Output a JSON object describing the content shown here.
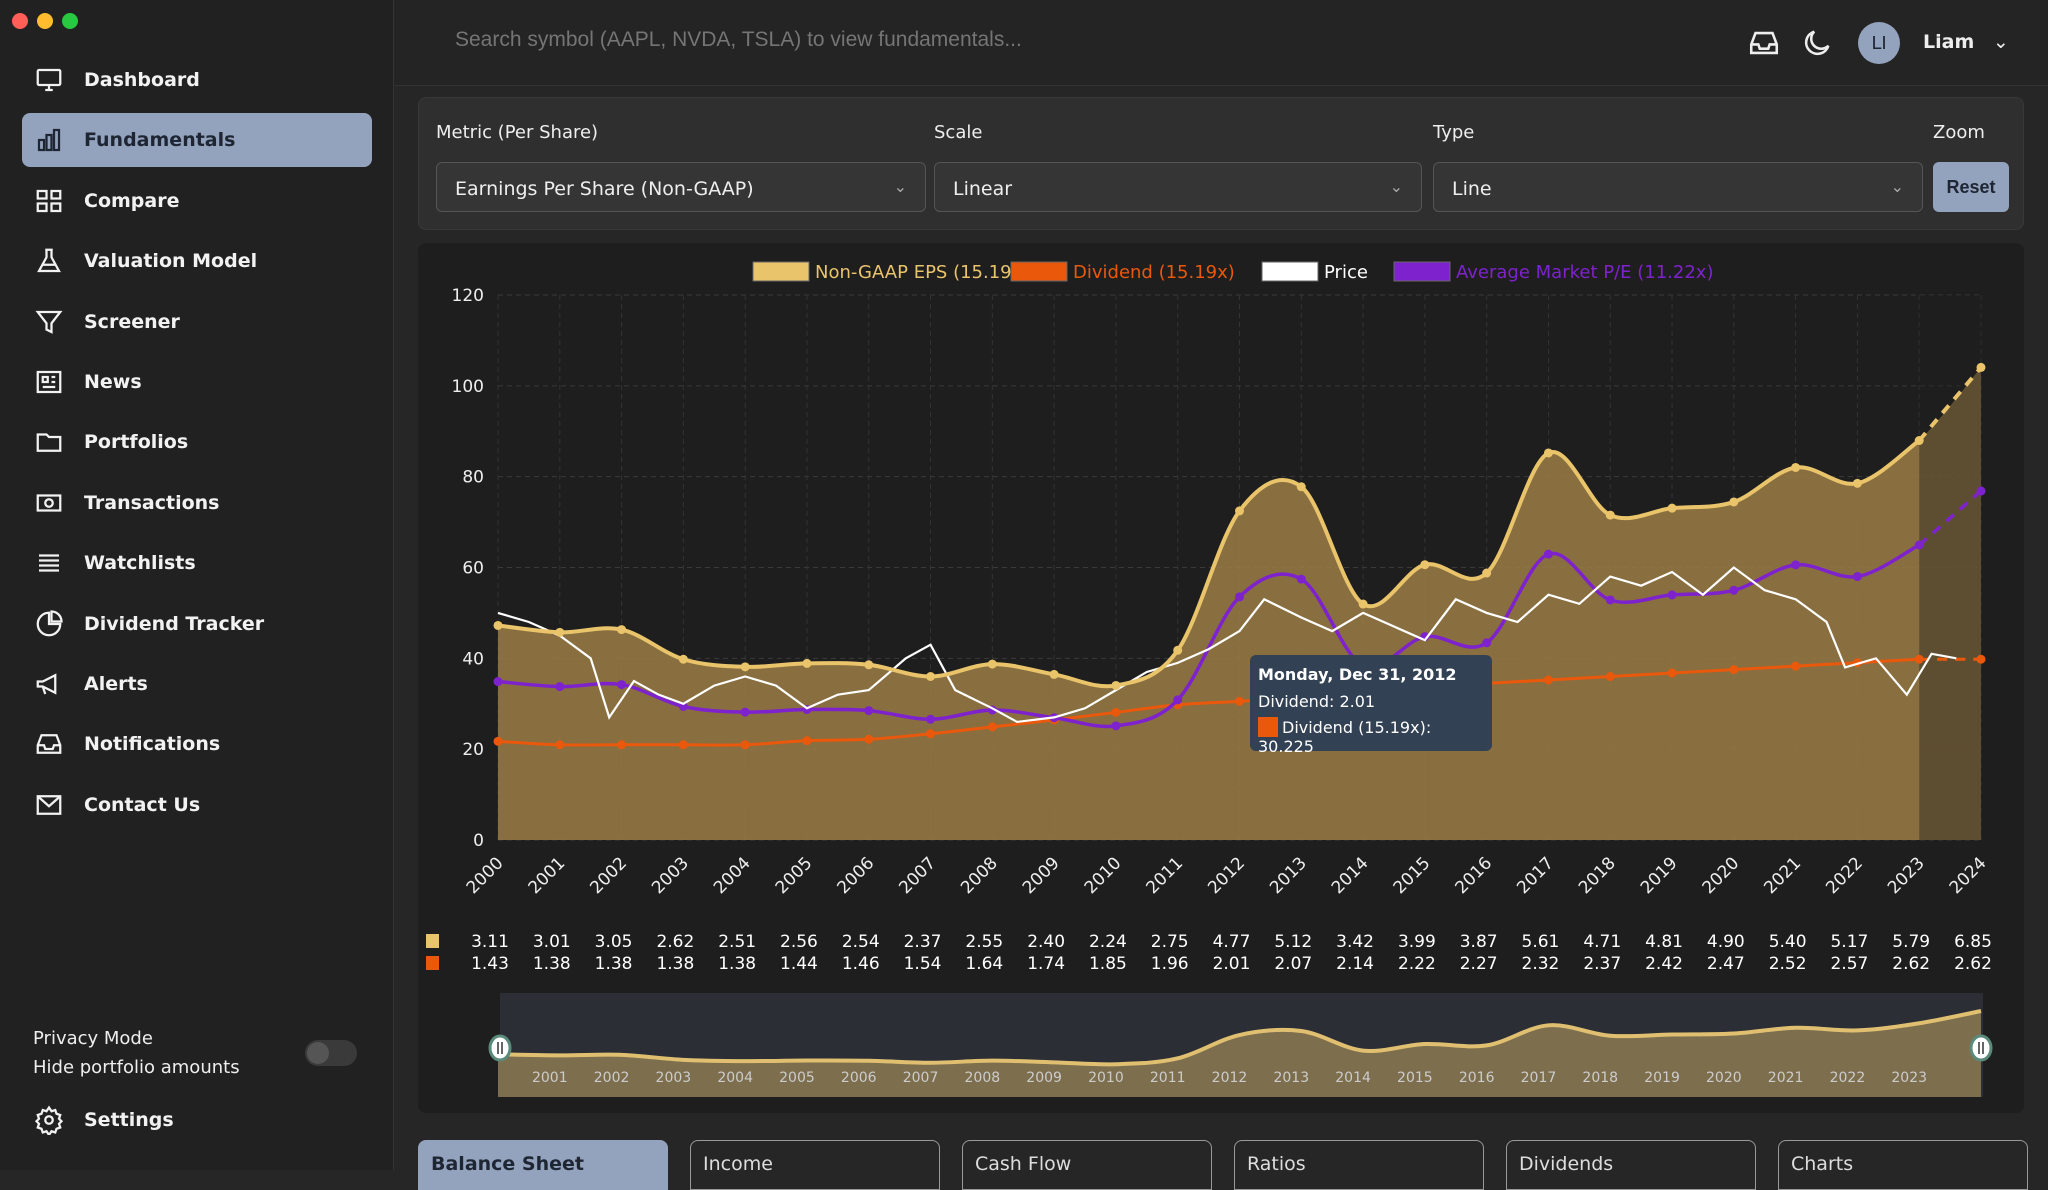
{
  "sidebar": {
    "items": [
      {
        "label": "Dashboard",
        "icon": "monitor-icon"
      },
      {
        "label": "Fundamentals",
        "icon": "bar-chart-icon",
        "active": true
      },
      {
        "label": "Compare",
        "icon": "compare-icon"
      },
      {
        "label": "Valuation Model",
        "icon": "flask-icon"
      },
      {
        "label": "Screener",
        "icon": "filter-icon"
      },
      {
        "label": "News",
        "icon": "newspaper-icon"
      },
      {
        "label": "Portfolios",
        "icon": "folder-icon"
      },
      {
        "label": "Transactions",
        "icon": "money-icon"
      },
      {
        "label": "Watchlists",
        "icon": "list-icon"
      },
      {
        "label": "Dividend Tracker",
        "icon": "pie-icon"
      },
      {
        "label": "Alerts",
        "icon": "megaphone-icon"
      },
      {
        "label": "Notifications",
        "icon": "inbox-icon"
      },
      {
        "label": "Contact Us",
        "icon": "mail-icon"
      }
    ],
    "privacy_title": "Privacy Mode",
    "privacy_sub": "Hide portfolio amounts",
    "privacy_on": false,
    "settings": "Settings"
  },
  "topbar": {
    "search_placeholder": "Search symbol (AAPL, NVDA, TSLA) to view fundamentals...",
    "avatar": "LI",
    "user": "Liam"
  },
  "filters": {
    "metric_label": "Metric (Per Share)",
    "metric": "Earnings Per Share (Non-GAAP)",
    "scale_label": "Scale",
    "scale": "Linear",
    "type_label": "Type",
    "type": "Line",
    "zoom_label": "Zoom",
    "reset": "Reset"
  },
  "tooltip": {
    "date": "Monday, Dec 31, 2012",
    "line1": "Dividend: 2.01",
    "line2": "Dividend (15.19x): 30.225"
  },
  "tabs": [
    "Balance Sheet",
    "Income",
    "Cash Flow",
    "Ratios",
    "Dividends",
    "Charts"
  ],
  "chart_data": {
    "type": "line",
    "ylim": [
      0,
      120
    ],
    "yticks": [
      0,
      20,
      40,
      60,
      80,
      100,
      120
    ],
    "x": [
      2000,
      2001,
      2002,
      2003,
      2004,
      2005,
      2006,
      2007,
      2008,
      2009,
      2010,
      2011,
      2012,
      2013,
      2014,
      2015,
      2016,
      2017,
      2018,
      2019,
      2020,
      2021,
      2022,
      2023,
      2024
    ],
    "forecast_from": 2023,
    "legend": [
      {
        "name": "Non-GAAP EPS (15.19x)",
        "color": "#e9c46a"
      },
      {
        "name": "Dividend (15.19x)",
        "color": "#ea580c"
      },
      {
        "name": "Price",
        "color": "#ffffff"
      },
      {
        "name": "Average Market P/E (11.22x)",
        "color": "#7e22ce"
      }
    ],
    "eps": [
      3.11,
      3.01,
      3.05,
      2.62,
      2.51,
      2.56,
      2.54,
      2.37,
      2.55,
      2.4,
      2.24,
      2.75,
      4.77,
      5.12,
      3.42,
      3.99,
      3.87,
      5.61,
      4.71,
      4.81,
      4.9,
      5.4,
      5.17,
      5.79,
      6.85
    ],
    "dividend": [
      1.43,
      1.38,
      1.38,
      1.38,
      1.38,
      1.44,
      1.46,
      1.54,
      1.64,
      1.74,
      1.85,
      1.96,
      2.01,
      2.07,
      2.14,
      2.22,
      2.27,
      2.32,
      2.37,
      2.42,
      2.47,
      2.52,
      2.57,
      2.62,
      2.62
    ],
    "eps_multiple": 15.19,
    "div_multiple": 15.19,
    "pe_multiple": 11.22,
    "price": [
      [
        2000,
        50
      ],
      [
        2000.5,
        48
      ],
      [
        2001,
        45
      ],
      [
        2001.5,
        40
      ],
      [
        2001.8,
        27
      ],
      [
        2002.2,
        35
      ],
      [
        2002.6,
        32
      ],
      [
        2003,
        30
      ],
      [
        2003.5,
        34
      ],
      [
        2004,
        36
      ],
      [
        2004.5,
        34
      ],
      [
        2005,
        29
      ],
      [
        2005.5,
        32
      ],
      [
        2006,
        33
      ],
      [
        2006.6,
        40
      ],
      [
        2007,
        43
      ],
      [
        2007.4,
        33
      ],
      [
        2008,
        29
      ],
      [
        2008.4,
        26
      ],
      [
        2009,
        27
      ],
      [
        2009.5,
        29
      ],
      [
        2010,
        33
      ],
      [
        2010.5,
        37
      ],
      [
        2011,
        39
      ],
      [
        2011.5,
        42
      ],
      [
        2012,
        46
      ],
      [
        2012.4,
        53
      ],
      [
        2013,
        49
      ],
      [
        2013.5,
        46
      ],
      [
        2014,
        50
      ],
      [
        2014.5,
        47
      ],
      [
        2015,
        44
      ],
      [
        2015.5,
        53
      ],
      [
        2016,
        50
      ],
      [
        2016.5,
        48
      ],
      [
        2017,
        54
      ],
      [
        2017.5,
        52
      ],
      [
        2018,
        58
      ],
      [
        2018.5,
        56
      ],
      [
        2019,
        59
      ],
      [
        2019.5,
        54
      ],
      [
        2020,
        60
      ],
      [
        2020.5,
        55
      ],
      [
        2021,
        53
      ],
      [
        2021.5,
        48
      ],
      [
        2021.8,
        38
      ],
      [
        2022.3,
        40
      ],
      [
        2022.8,
        32
      ],
      [
        2023.2,
        41
      ],
      [
        2023.6,
        40
      ]
    ],
    "navigator_years": [
      2001,
      2002,
      2003,
      2004,
      2005,
      2006,
      2007,
      2008,
      2009,
      2010,
      2011,
      2012,
      2013,
      2014,
      2015,
      2016,
      2017,
      2018,
      2019,
      2020,
      2021,
      2022,
      2023
    ]
  }
}
